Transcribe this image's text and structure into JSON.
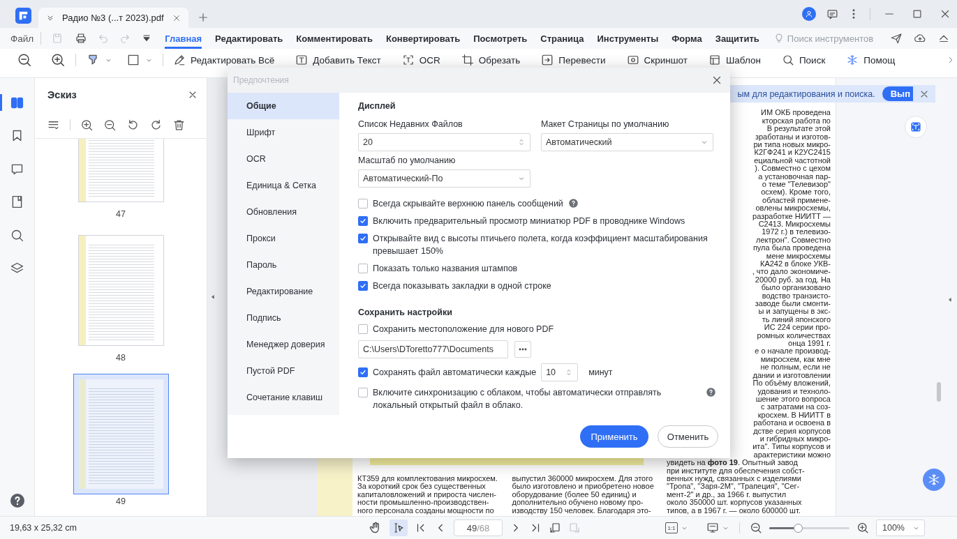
{
  "tab": {
    "title": "Радио №3 (...т 2023).pdf"
  },
  "menu": {
    "file": "Файл",
    "tabs": [
      {
        "label": "Главная",
        "selected": true
      },
      {
        "label": "Редактировать",
        "selected": false
      },
      {
        "label": "Комментировать",
        "selected": false
      },
      {
        "label": "Конвертировать",
        "selected": false
      },
      {
        "label": "Посмотреть",
        "selected": false
      },
      {
        "label": "Страница",
        "selected": false
      },
      {
        "label": "Инструменты",
        "selected": false
      },
      {
        "label": "Форма",
        "selected": false
      },
      {
        "label": "Защитить",
        "selected": false
      }
    ],
    "tool_search": {
      "placeholder": "Поиск инструментов"
    }
  },
  "toolbar": {
    "items": [
      {
        "kind": "edit",
        "label": "Редактировать Всё"
      },
      {
        "kind": "text",
        "label": "Добавить Текст"
      },
      {
        "kind": "ocr",
        "label": "OCR"
      },
      {
        "kind": "crop",
        "label": "Обрезать"
      },
      {
        "kind": "translate",
        "label": "Перевести"
      },
      {
        "kind": "screenshot",
        "label": "Скриншот"
      },
      {
        "kind": "template",
        "label": "Шаблон"
      },
      {
        "kind": "search",
        "label": "Поиск"
      },
      {
        "kind": "assistant",
        "label": "Помощ"
      }
    ]
  },
  "side_rail": [
    {
      "kind": "thumbnails",
      "selected": true
    },
    {
      "kind": "bookmarks",
      "selected": false
    },
    {
      "kind": "comments",
      "selected": false
    },
    {
      "kind": "attachments",
      "selected": false
    },
    {
      "kind": "search",
      "selected": false
    },
    {
      "kind": "layers",
      "selected": false
    }
  ],
  "sidebar": {
    "title": "Эскиз",
    "thumbnails": [
      {
        "page": "47",
        "selected": false
      },
      {
        "page": "48",
        "selected": false
      },
      {
        "page": "49",
        "selected": true
      }
    ]
  },
  "notification": {
    "text": "ым для редактирования и поиска.",
    "button": "Вып"
  },
  "document": {
    "columns": [
      {
        "lines": [
          "КТ359 для комплектования микросхем.",
          "За короткий срок без существенных",
          "капиталовложений и прироста числен-",
          "ности промышленно-производствен-",
          "ного персонала созданы мощности по"
        ]
      },
      {
        "lines": [
          "выпустил 360000 микросхем. Для этого",
          "было изготовлено и приобретено новое",
          "оборудование (более 50 единиц) и",
          "дополнительно обучено новому про-",
          "изводству 150 человек. Благодаря это-"
        ]
      },
      {
        "cut_lines": [
          "ИМ ОКБ проведена",
          "кторская работа по",
          "В результате этой",
          "зработаны и изготов-",
          "ри типа новых микро-",
          "К2ГФ241 и К2УС2415",
          "ециальной частотной",
          "). Совместно с цехом",
          "а установочная пар-",
          "о теме \"Телевизор\"",
          "осхем). Кроме того,",
          "областей примене-",
          "овлены микросхемы,",
          "разработке НИИТТ —",
          "С2413. Микросхемы",
          "1972 г.) в телевизо-",
          "лектрон\". Совместно",
          "пула была проведена",
          "мене микросхемы",
          "КА242 в блоке УКВ-",
          ", что дало экономиче-",
          "20000 руб. за год. На",
          "было организовано",
          "водство транзисто-",
          "заводе были смонти-",
          "ы и запущены в экс-",
          "ть линий японского",
          "ИС 224 серии про-",
          "ромных количествах",
          "онца 1991 г.",
          "е о начале производ-",
          "микросхем, как мне",
          "не полным, если не",
          "дании и изготовлении",
          "По объёму вложений,",
          "удования и техноло-",
          "шение этого вопроса",
          "с затратами на соз-",
          "кросхем. В НИИТТ в",
          "работана и освоена в",
          "дстве серия корпусов",
          "и гибридных микро-",
          "ита\". Типы корпусов и",
          "арактеристики можно"
        ],
        "lines": [
          "увидеть на **фото 19**. Опытный завод",
          "при институте для обеспечения собст-",
          "венных нужд, связанных с изделиями",
          "\"Тропа\", \"Заря-2М\", \"Трапеция\", \"Сег-",
          "мент-2\" и др., за 1966 г. выпустил",
          "около 350000 шт. корпусов указанных",
          "типов, а в 1967 г. — около 600000 шт."
        ]
      }
    ]
  },
  "dialog": {
    "title": "Предпочтения",
    "nav": [
      {
        "label": "Общие",
        "selected": true
      },
      {
        "label": "Шрифт",
        "selected": false
      },
      {
        "label": "OCR",
        "selected": false
      },
      {
        "label": "Единица & Сетка",
        "selected": false
      },
      {
        "label": "Обновления",
        "selected": false
      },
      {
        "label": "Прокси",
        "selected": false
      },
      {
        "label": "Пароль",
        "selected": false
      },
      {
        "label": "Редактирование",
        "selected": false
      },
      {
        "label": "Подпись",
        "selected": false
      },
      {
        "label": "Менеджер доверия",
        "selected": false
      },
      {
        "label": "Пустой PDF",
        "selected": false
      },
      {
        "label": "Сочетание клавиш",
        "selected": false
      }
    ],
    "display": {
      "heading": "Дисплей",
      "recent_files": {
        "label": "Список Недавних Файлов",
        "value": "20"
      },
      "page_layout": {
        "label": "Макет Страницы по умолчанию",
        "value": "Автоматический"
      },
      "default_zoom": {
        "label": "Масштаб по умолчанию",
        "value": "Автоматический-По"
      },
      "options": [
        {
          "label": "Всегда скрывайте верхнюю панель сообщений",
          "checked": false,
          "help": true
        },
        {
          "label": "Включить предварительный просмотр миниатюр PDF в проводнике Windows",
          "checked": true,
          "help": false
        },
        {
          "label": "Открывайте вид с высоты птичьего полета, когда коэффициент масштабирования превышает 150%",
          "checked": true,
          "help": false
        },
        {
          "label": "Показать только названия штампов",
          "checked": false,
          "help": false
        },
        {
          "label": "Всегда показывать закладки в одной строке",
          "checked": true,
          "help": false
        }
      ]
    },
    "save": {
      "heading": "Сохранить настройки",
      "save_location": {
        "label": "Сохранить местоположение для нового PDF",
        "checked": false
      },
      "path": {
        "value": "C:\\Users\\DToretto777\\Documents"
      },
      "autosave": {
        "label": "Сохранять файл автоматически каждые",
        "checked": true,
        "value": "10",
        "unit": "минут"
      },
      "cloud_sync": {
        "label": "Включите синхронизацию с облаком, чтобы автоматически отправлять локальный открытый файл в облако.",
        "checked": false,
        "help": true
      }
    },
    "buttons": [
      {
        "label": "Применить",
        "kind": "primary"
      },
      {
        "label": "Отменить",
        "kind": "secondary"
      }
    ]
  },
  "status_bar": {
    "page_size": "19,63 x 25,32 cm",
    "page": "49",
    "page_total": "/68",
    "actual_size": "1:1",
    "zoom_slider": {
      "level": 0.36
    },
    "zoom": "100%"
  }
}
